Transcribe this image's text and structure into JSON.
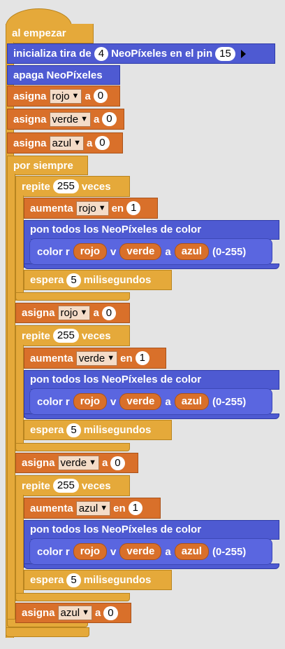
{
  "start": {
    "label": "al empezar"
  },
  "init": {
    "prefix": "inicializa tira de",
    "count": "4",
    "middle": "NeoPíxeles en el pin",
    "pin": "15"
  },
  "off": {
    "label": "apaga NeoPíxeles"
  },
  "words": {
    "assign": "asigna",
    "to": "a",
    "forever": "por siempre",
    "repeat": "repite",
    "times": "veces",
    "increase": "aumenta",
    "by": "en",
    "setall": "pon todos los NeoPíxeles de color",
    "colr": "color r",
    "v": "v",
    "a": "a",
    "range": "(0-255)",
    "wait": "espera",
    "ms": "milisegundos"
  },
  "vars": {
    "red": "rojo",
    "green": "verde",
    "blue": "azul"
  },
  "values": {
    "zero": "0",
    "one": "1",
    "reps": "255",
    "delay": "5"
  },
  "icons": {
    "dropdown": "▼"
  }
}
